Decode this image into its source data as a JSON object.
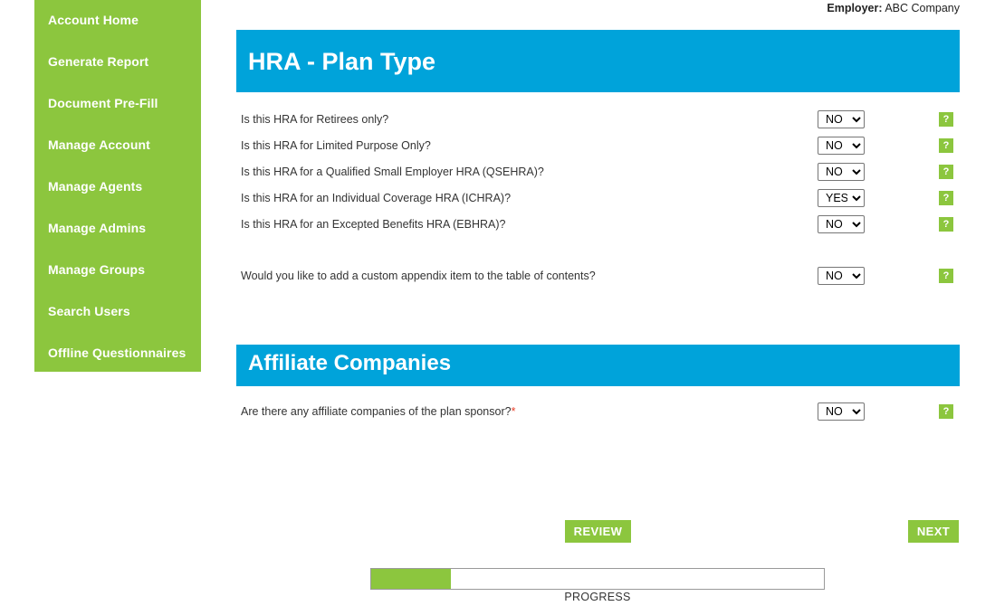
{
  "header": {
    "employer_label": "Employer:",
    "employer_name": "ABC Company"
  },
  "sidebar": {
    "items": [
      {
        "label": "Account Home"
      },
      {
        "label": "Generate Report"
      },
      {
        "label": "Document Pre-Fill"
      },
      {
        "label": "Manage Account"
      },
      {
        "label": "Manage Agents"
      },
      {
        "label": "Manage Admins"
      },
      {
        "label": "Manage Groups"
      },
      {
        "label": "Search Users"
      },
      {
        "label": "Offline Questionnaires"
      }
    ]
  },
  "sections": [
    {
      "title": "HRA - Plan Type",
      "questions": [
        {
          "label": "Is this HRA for Retirees only?",
          "value": "NO",
          "options": [
            "NO",
            "YES"
          ],
          "help": "?",
          "required": false
        },
        {
          "label": "Is this HRA for Limited Purpose Only?",
          "value": "NO",
          "options": [
            "NO",
            "YES"
          ],
          "help": "?",
          "required": false
        },
        {
          "label": "Is this HRA for a Qualified Small Employer HRA (QSEHRA)?",
          "value": "NO",
          "options": [
            "NO",
            "YES"
          ],
          "help": "?",
          "required": false
        },
        {
          "label": "Is this HRA for an Individual Coverage HRA (ICHRA)?",
          "value": "YES",
          "options": [
            "NO",
            "YES"
          ],
          "help": "?",
          "required": false
        },
        {
          "label": "Is this HRA for an Excepted Benefits HRA (EBHRA)?",
          "value": "NO",
          "options": [
            "NO",
            "YES"
          ],
          "help": "?",
          "required": false
        },
        {
          "label": "Would you like to add a custom appendix item to the table of contents?",
          "value": "NO",
          "options": [
            "NO",
            "YES"
          ],
          "help": "?",
          "required": false
        }
      ]
    },
    {
      "title": "Affiliate Companies",
      "questions": [
        {
          "label": "Are there any affiliate companies of the plan sponsor?",
          "value": "NO",
          "options": [
            "NO",
            "YES"
          ],
          "help": "?",
          "required": true
        }
      ]
    }
  ],
  "footer": {
    "review_label": "REVIEW",
    "next_label": "NEXT",
    "progress_label": "PROGRESS",
    "progress_percent": 17.5
  },
  "colors": {
    "green": "#8CC63E",
    "blue": "#00A3DA",
    "required_star": "#E8402A"
  }
}
